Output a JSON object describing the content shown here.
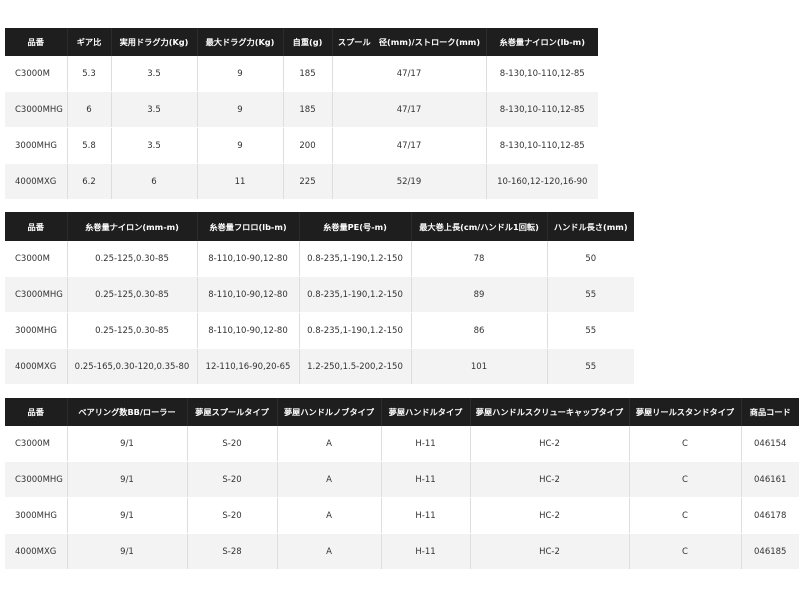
{
  "table1": {
    "headers": [
      "品番",
      "ギア比",
      "実用ドラグ力(Kg)",
      "最大ドラグ力(Kg)",
      "自重(g)",
      "スプール　径(mm)/ストローク(mm)",
      "糸巻量ナイロン(lb-m)"
    ],
    "rows": [
      [
        "C3000M",
        "5.3",
        "3.5",
        "9",
        "185",
        "47/17",
        "8-130,10-110,12-85"
      ],
      [
        "C3000MHG",
        "6",
        "3.5",
        "9",
        "185",
        "47/17",
        "8-130,10-110,12-85"
      ],
      [
        "3000MHG",
        "5.8",
        "3.5",
        "9",
        "200",
        "47/17",
        "8-130,10-110,12-85"
      ],
      [
        "4000MXG",
        "6.2",
        "6",
        "11",
        "225",
        "52/19",
        "10-160,12-120,16-90"
      ]
    ]
  },
  "table2": {
    "headers": [
      "品番",
      "糸巻量ナイロン(mm-m)",
      "糸巻量フロロ(lb-m)",
      "糸巻量PE(号-m)",
      "最大巻上長(cm/ハンドル1回転)",
      "ハンドル長さ(mm)"
    ],
    "rows": [
      [
        "C3000M",
        "0.25-125,0.30-85",
        "8-110,10-90,12-80",
        "0.8-235,1-190,1.2-150",
        "78",
        "50"
      ],
      [
        "C3000MHG",
        "0.25-125,0.30-85",
        "8-110,10-90,12-80",
        "0.8-235,1-190,1.2-150",
        "89",
        "55"
      ],
      [
        "3000MHG",
        "0.25-125,0.30-85",
        "8-110,10-90,12-80",
        "0.8-235,1-190,1.2-150",
        "86",
        "55"
      ],
      [
        "4000MXG",
        "0.25-165,0.30-120,0.35-80",
        "12-110,16-90,20-65",
        "1.2-250,1.5-200,2-150",
        "101",
        "55"
      ]
    ]
  },
  "table3": {
    "headers": [
      "品番",
      "ベアリング数BB/ローラー",
      "夢屋スプールタイプ",
      "夢屋ハンドルノブタイプ",
      "夢屋ハンドルタイプ",
      "夢屋ハンドルスクリューキャップタイプ",
      "夢屋リールスタンドタイプ",
      "商品コード"
    ],
    "rows": [
      [
        "C3000M",
        "9/1",
        "S-20",
        "A",
        "H-11",
        "HC-2",
        "C",
        "046154"
      ],
      [
        "C3000MHG",
        "9/1",
        "S-20",
        "A",
        "H-11",
        "HC-2",
        "C",
        "046161"
      ],
      [
        "3000MHG",
        "9/1",
        "S-20",
        "A",
        "H-11",
        "HC-2",
        "C",
        "046178"
      ],
      [
        "4000MXG",
        "9/1",
        "S-28",
        "A",
        "H-11",
        "HC-2",
        "C",
        "046185"
      ]
    ]
  }
}
